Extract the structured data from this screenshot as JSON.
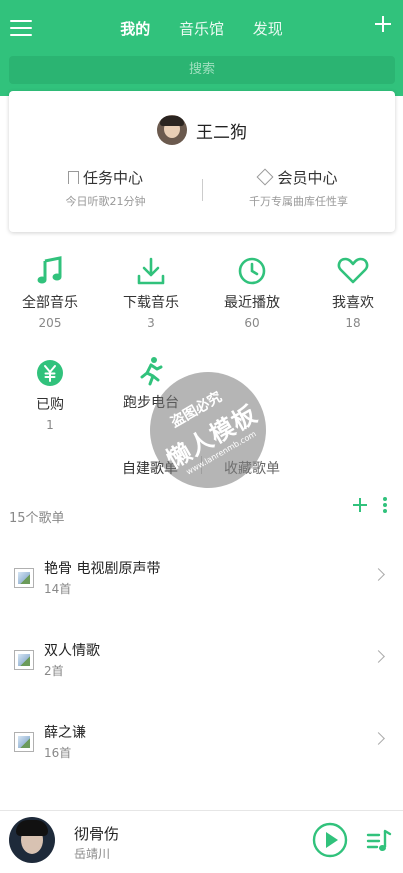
{
  "header": {
    "tabs": [
      {
        "label": "我的",
        "active": true
      },
      {
        "label": "音乐馆",
        "active": false
      },
      {
        "label": "发现",
        "active": false
      }
    ],
    "search_placeholder": "搜索",
    "accent_color": "#31c27c"
  },
  "user": {
    "name": "王二狗",
    "task_center": {
      "title": "任务中心",
      "subtitle": "今日听歌21分钟"
    },
    "vip_center": {
      "title": "会员中心",
      "subtitle": "千万专属曲库任性享"
    }
  },
  "grid": [
    {
      "label": "全部音乐",
      "count": "205",
      "icon": "music-note-icon"
    },
    {
      "label": "下载音乐",
      "count": "3",
      "icon": "download-icon"
    },
    {
      "label": "最近播放",
      "count": "60",
      "icon": "clock-icon"
    },
    {
      "label": "我喜欢",
      "count": "18",
      "icon": "heart-icon"
    },
    {
      "label": "已购",
      "count": "1",
      "icon": "yen-icon"
    },
    {
      "label": "跑步电台",
      "count": "",
      "icon": "running-icon"
    }
  ],
  "playlist_tabs": [
    "自建歌单",
    "收藏歌单"
  ],
  "playlist_count": "15个歌单",
  "playlists": [
    {
      "title": "艳骨 电视剧原声带",
      "count": "14首"
    },
    {
      "title": "双人情歌",
      "count": "2首"
    },
    {
      "title": "薛之谦",
      "count": "16首"
    }
  ],
  "player": {
    "song": "彻骨伤",
    "artist": "岳靖川"
  },
  "watermark": {
    "line1": "盗图必究",
    "line2": "懒人模板",
    "line3": "www.lanrenmb.com"
  }
}
